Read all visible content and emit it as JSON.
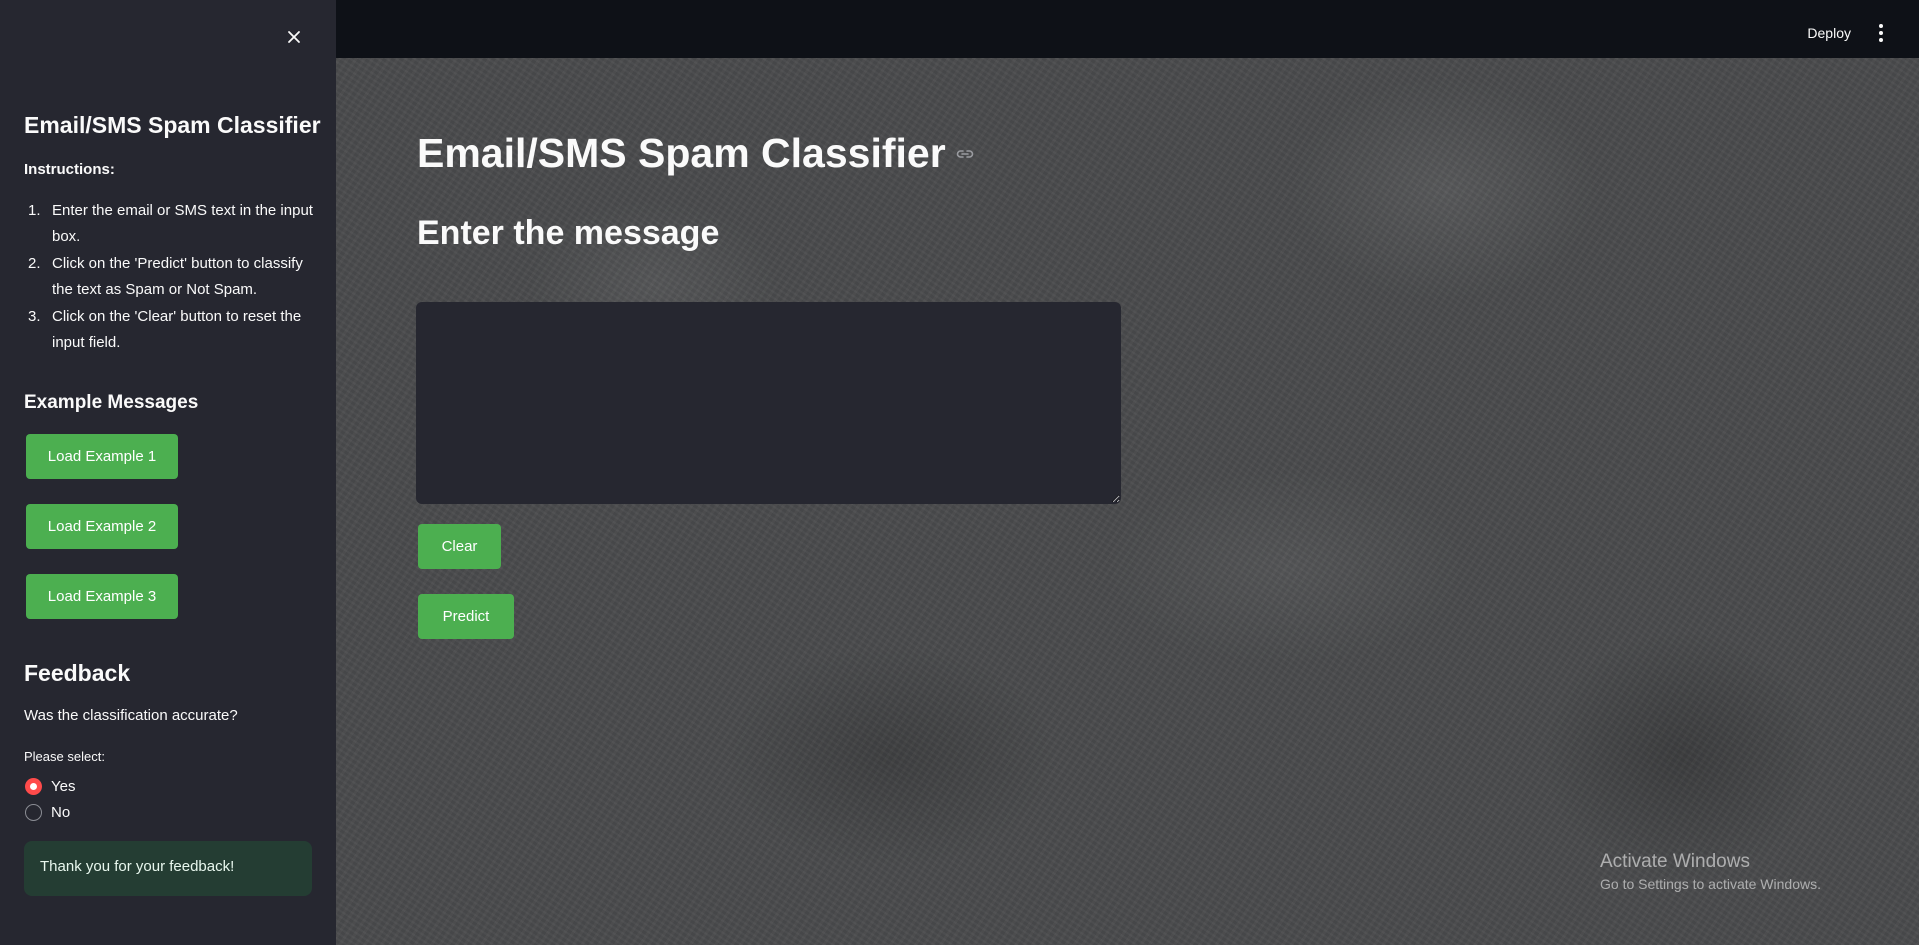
{
  "header": {
    "deploy_label": "Deploy"
  },
  "sidebar": {
    "title": "Email/SMS Spam Classifier",
    "instructions_heading": "Instructions:",
    "instructions": [
      {
        "num": "1.",
        "text": "Enter the email or SMS text in the input box."
      },
      {
        "num": "2.",
        "text": "Click on the 'Predict' button to classify the text as Spam or Not Spam."
      },
      {
        "num": "3.",
        "text": "Click on the 'Clear' button to reset the input field."
      }
    ],
    "examples_heading": "Example Messages",
    "example_buttons": [
      "Load Example 1",
      "Load Example 2",
      "Load Example 3"
    ],
    "feedback": {
      "heading": "Feedback",
      "question": "Was the classification accurate?",
      "select_label": "Please select:",
      "options": [
        {
          "label": "Yes",
          "selected": true
        },
        {
          "label": "No",
          "selected": false
        }
      ],
      "success_message": "Thank you for your feedback!"
    }
  },
  "main": {
    "title": "Email/SMS Spam Classifier",
    "subtitle": "Enter the message",
    "message_value": "",
    "clear_label": "Clear",
    "predict_label": "Predict"
  },
  "watermark": {
    "line1": "Activate Windows",
    "line2": "Go to Settings to activate Windows."
  },
  "colors": {
    "accent_green": "#4caf50",
    "radio_selected": "#ff4b4b",
    "sidebar_bg": "#262730",
    "header_bg": "#0e1117"
  }
}
